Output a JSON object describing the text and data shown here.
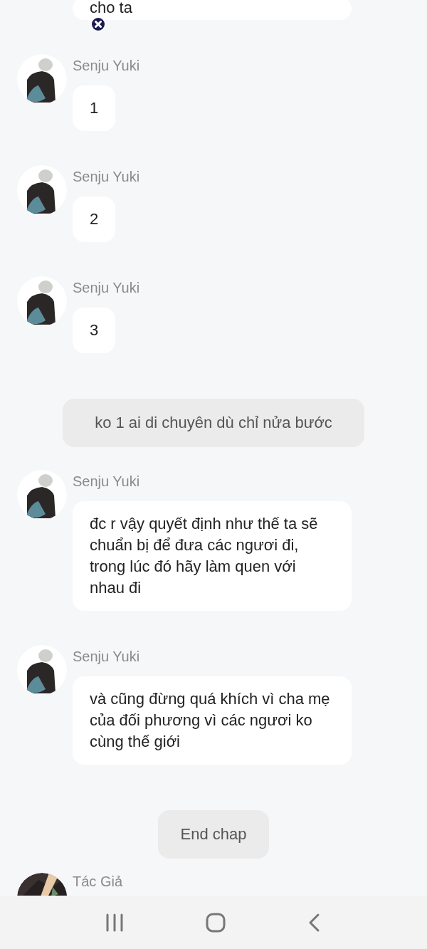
{
  "messages": [
    {
      "kind": "partial",
      "text": "cho ta"
    },
    {
      "kind": "message",
      "sender": "Senju Yuki",
      "text": "1"
    },
    {
      "kind": "message",
      "sender": "Senju Yuki",
      "text": "2"
    },
    {
      "kind": "message",
      "sender": "Senju Yuki",
      "text": "3"
    },
    {
      "kind": "narration",
      "text": "ko 1 ai di chuyên dù chỉ nửa bước"
    },
    {
      "kind": "message",
      "sender": "Senju Yuki",
      "text": "đc r vậy quyết định như thế ta sẽ chuẩn bị để đưa các ngươi đi, trong lúc đó hãy làm quen với nhau đi"
    },
    {
      "kind": "message",
      "sender": "Senju Yuki",
      "text": "và cũng đừng quá khích vì cha mẹ của đối phương vì các ngươi ko cùng thế giới"
    },
    {
      "kind": "end",
      "text": "End chap"
    },
    {
      "kind": "author",
      "sender": "Tác Giả"
    }
  ]
}
